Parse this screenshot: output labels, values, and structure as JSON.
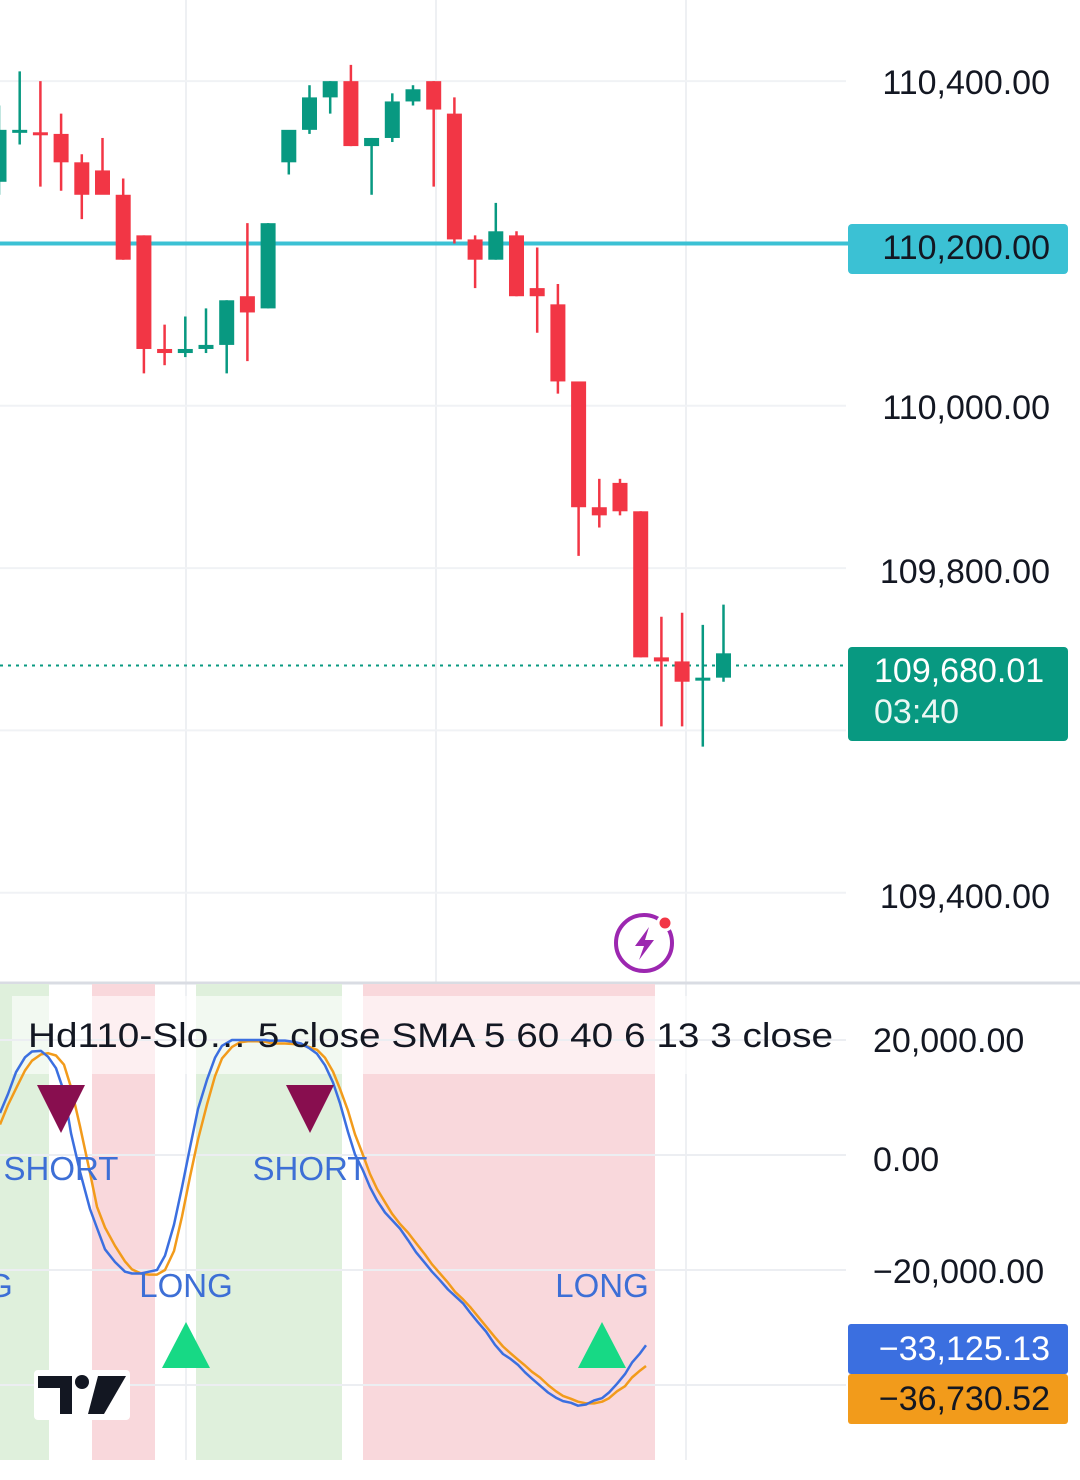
{
  "colors": {
    "up": "#089981",
    "down": "#f23645",
    "level_line": "#3bc1d4",
    "fast_line": "#3b6fe0",
    "slow_line": "#f29b1b",
    "long_marker": "#17d985",
    "short_marker": "#880e4f",
    "signal_text": "#3d6fd6",
    "zone_green": "#dff0dc",
    "zone_red": "#f9d8dc",
    "flash_icon": "#9c27b0",
    "flash_dot": "#f23645"
  },
  "icons": {
    "flash": "flash-icon",
    "logo": "tradingview-logo-icon"
  },
  "chart_data": [
    {
      "type": "candlestick",
      "ylim": [
        109290,
        110500
      ],
      "y_ticks": [
        "110,400.00",
        "110,200.00",
        "110,000.00",
        "109,800.00",
        "109,400.00"
      ],
      "y_tick_values": [
        110400,
        110200,
        110000,
        109800,
        109400
      ],
      "level_line": {
        "value": 110200,
        "label": "110,200.00"
      },
      "current_price": {
        "value": 109680.01,
        "label": "109,680.01",
        "countdown": "03:40"
      },
      "candles": [
        {
          "o": 110276,
          "h": 110370,
          "l": 110260,
          "c": 110340
        },
        {
          "o": 110337,
          "h": 110412,
          "l": 110322,
          "c": 110340
        },
        {
          "o": 110337,
          "h": 110400,
          "l": 110270,
          "c": 110335
        },
        {
          "o": 110335,
          "h": 110360,
          "l": 110265,
          "c": 110300
        },
        {
          "o": 110300,
          "h": 110310,
          "l": 110230,
          "c": 110260
        },
        {
          "o": 110290,
          "h": 110330,
          "l": 110280,
          "c": 110260
        },
        {
          "o": 110260,
          "h": 110280,
          "l": 110180,
          "c": 110180
        },
        {
          "o": 110210,
          "h": 110210,
          "l": 110040,
          "c": 110070
        },
        {
          "o": 110070,
          "h": 110100,
          "l": 110050,
          "c": 110065
        },
        {
          "o": 110065,
          "h": 110110,
          "l": 110060,
          "c": 110070
        },
        {
          "o": 110070,
          "h": 110120,
          "l": 110065,
          "c": 110075
        },
        {
          "o": 110075,
          "h": 110130,
          "l": 110040,
          "c": 110130
        },
        {
          "o": 110135,
          "h": 110225,
          "l": 110055,
          "c": 110115
        },
        {
          "o": 110120,
          "h": 110225,
          "l": 110120,
          "c": 110225
        },
        {
          "o": 110300,
          "h": 110330,
          "l": 110285,
          "c": 110340
        },
        {
          "o": 110340,
          "h": 110395,
          "l": 110335,
          "c": 110380
        },
        {
          "o": 110380,
          "h": 110400,
          "l": 110360,
          "c": 110400
        },
        {
          "o": 110400,
          "h": 110420,
          "l": 110320,
          "c": 110320
        },
        {
          "o": 110320,
          "h": 110330,
          "l": 110260,
          "c": 110330
        },
        {
          "o": 110330,
          "h": 110385,
          "l": 110325,
          "c": 110375
        },
        {
          "o": 110375,
          "h": 110395,
          "l": 110370,
          "c": 110390
        },
        {
          "o": 110400,
          "h": 110400,
          "l": 110270,
          "c": 110365
        },
        {
          "o": 110360,
          "h": 110380,
          "l": 110200,
          "c": 110205
        },
        {
          "o": 110205,
          "h": 110210,
          "l": 110145,
          "c": 110180
        },
        {
          "o": 110180,
          "h": 110250,
          "l": 110180,
          "c": 110215
        },
        {
          "o": 110210,
          "h": 110215,
          "l": 110135,
          "c": 110135
        },
        {
          "o": 110145,
          "h": 110195,
          "l": 110090,
          "c": 110135
        },
        {
          "o": 110125,
          "h": 110150,
          "l": 110015,
          "c": 110030
        },
        {
          "o": 110030,
          "h": 110030,
          "l": 109815,
          "c": 109875
        },
        {
          "o": 109875,
          "h": 109910,
          "l": 109850,
          "c": 109865
        },
        {
          "o": 109905,
          "h": 109910,
          "l": 109865,
          "c": 109870
        },
        {
          "o": 109870,
          "h": 109870,
          "l": 109690,
          "c": 109690
        },
        {
          "o": 109690,
          "h": 109740,
          "l": 109605,
          "c": 109685
        },
        {
          "o": 109685,
          "h": 109745,
          "l": 109605,
          "c": 109660
        },
        {
          "o": 109665,
          "h": 109730,
          "l": 109580,
          "c": 109665
        },
        {
          "o": 109665,
          "h": 109755,
          "l": 109660,
          "c": 109695
        }
      ]
    },
    {
      "type": "line",
      "legend": "Hd110-Slo… 5 close SMA 5 60 40 6 13 3 close",
      "ylim": [
        -46000,
        26000
      ],
      "y_ticks": [
        "20,000.00",
        "0.00",
        "−20,000.00"
      ],
      "y_tick_values": [
        20000,
        0,
        -20000
      ],
      "series": [
        {
          "role": "fast",
          "value_label": "−33,125.13",
          "x": [
            0,
            8,
            16,
            25,
            32,
            41,
            48,
            56,
            64,
            71,
            80,
            90,
            97,
            105,
            115,
            125,
            132,
            141,
            149,
            157,
            165,
            174,
            182,
            190,
            198,
            207,
            215,
            222,
            232,
            240,
            248,
            257,
            265,
            270,
            277,
            285,
            293,
            301,
            309,
            317,
            325,
            333,
            340,
            348,
            355,
            363,
            370,
            377,
            385,
            392,
            400,
            408,
            416,
            425,
            432,
            440,
            448,
            455,
            463,
            470,
            478,
            486,
            495,
            503,
            510,
            518,
            525,
            532,
            540,
            548,
            556,
            563,
            571,
            578,
            586,
            594,
            602,
            609,
            617,
            625,
            632,
            640,
            646
          ],
          "values": [
            7300,
            10600,
            14400,
            17000,
            18000,
            18100,
            17100,
            15100,
            11000,
            3800,
            -2900,
            -9400,
            -12700,
            -16400,
            -18600,
            -20300,
            -20600,
            -20600,
            -20300,
            -20000,
            -17500,
            -12100,
            -5600,
            1300,
            8000,
            13100,
            16900,
            19000,
            20000,
            20000,
            20000,
            20000,
            20000,
            19900,
            19900,
            19900,
            19700,
            19400,
            18600,
            17600,
            15600,
            12600,
            9000,
            4000,
            100,
            -2700,
            -5600,
            -7900,
            -10000,
            -11300,
            -12800,
            -14800,
            -16900,
            -18800,
            -20300,
            -21800,
            -23400,
            -24500,
            -25800,
            -27400,
            -29100,
            -30700,
            -33000,
            -34600,
            -35400,
            -36500,
            -37800,
            -38900,
            -40100,
            -41300,
            -42200,
            -42800,
            -43100,
            -43600,
            -43400,
            -42700,
            -42300,
            -41300,
            -39800,
            -38100,
            -36100,
            -34500,
            -33100
          ]
        },
        {
          "role": "slow",
          "value_label": "−36,730.52",
          "x": [
            0,
            8,
            17,
            25,
            32,
            41,
            48,
            56,
            64,
            71,
            80,
            90,
            97,
            105,
            115,
            125,
            132,
            141,
            149,
            157,
            165,
            174,
            182,
            190,
            198,
            207,
            215,
            222,
            232,
            240,
            248,
            257,
            265,
            270,
            277,
            285,
            293,
            301,
            309,
            317,
            325,
            333,
            340,
            348,
            355,
            363,
            370,
            377,
            385,
            392,
            400,
            408,
            416,
            425,
            432,
            440,
            448,
            455,
            463,
            470,
            478,
            486,
            495,
            503,
            510,
            518,
            525,
            532,
            540,
            548,
            556,
            563,
            571,
            578,
            586,
            594,
            602,
            609,
            617,
            625,
            632,
            640,
            646
          ],
          "values": [
            5300,
            8700,
            11900,
            14700,
            16400,
            17500,
            17700,
            17300,
            15700,
            11800,
            5000,
            -3100,
            -9000,
            -12600,
            -15800,
            -18500,
            -19900,
            -20600,
            -20800,
            -20800,
            -20000,
            -16700,
            -10700,
            -3800,
            2700,
            8800,
            13700,
            16800,
            18800,
            19600,
            19800,
            19800,
            19700,
            19500,
            19400,
            19400,
            19300,
            19100,
            18800,
            18300,
            16900,
            14500,
            11500,
            7700,
            3600,
            0,
            -3300,
            -5900,
            -8200,
            -10200,
            -12000,
            -13500,
            -15300,
            -17300,
            -19000,
            -20600,
            -22200,
            -23800,
            -25100,
            -26400,
            -28100,
            -29800,
            -31700,
            -33300,
            -34400,
            -35600,
            -36600,
            -37700,
            -38700,
            -40000,
            -41100,
            -41900,
            -42400,
            -42900,
            -43200,
            -43200,
            -42900,
            -42300,
            -41100,
            -40200,
            -38700,
            -37500,
            -36700
          ]
        }
      ],
      "zones": [
        {
          "x0": 0,
          "x1": 49,
          "kind": "green"
        },
        {
          "x0": 92,
          "x1": 155,
          "kind": "red"
        },
        {
          "x0": 196,
          "x1": 342,
          "kind": "green"
        },
        {
          "x0": 363,
          "x1": 655,
          "kind": "red"
        }
      ],
      "signals": [
        {
          "kind": "short",
          "label": "SHORT",
          "x": 61
        },
        {
          "kind": "short",
          "label": "SHORT",
          "x": 310
        },
        {
          "kind": "long",
          "label": "LONG",
          "x": 186
        },
        {
          "kind": "long",
          "label": "LONG",
          "x": 602
        },
        {
          "kind": "long",
          "label": "G",
          "x": 0
        }
      ]
    }
  ]
}
